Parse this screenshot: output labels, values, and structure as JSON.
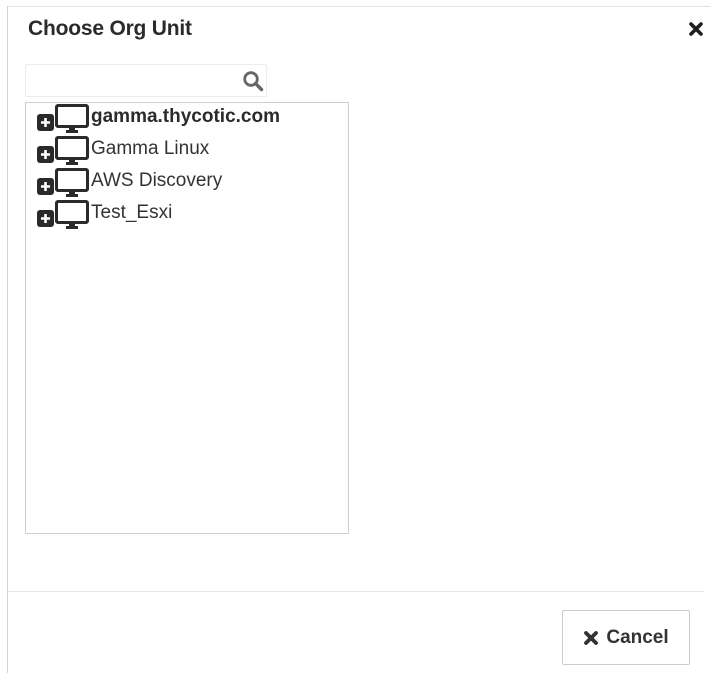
{
  "dialog": {
    "title": "Choose Org Unit",
    "close_icon": "close-icon"
  },
  "search": {
    "value": "",
    "placeholder": "",
    "icon": "search-icon"
  },
  "tree": {
    "items": [
      {
        "label": "gamma.thycotic.com",
        "selected": true,
        "icon": "computer-icon",
        "expand_icon": "expand-plus-icon"
      },
      {
        "label": "Gamma Linux",
        "selected": false,
        "icon": "computer-icon",
        "expand_icon": "expand-plus-icon"
      },
      {
        "label": "AWS Discovery",
        "selected": false,
        "icon": "computer-icon",
        "expand_icon": "expand-plus-icon"
      },
      {
        "label": "Test_Esxi",
        "selected": false,
        "icon": "computer-icon",
        "expand_icon": "expand-plus-icon"
      }
    ]
  },
  "footer": {
    "cancel_label": "Cancel",
    "cancel_icon": "times-icon"
  },
  "colors": {
    "text": "#333333",
    "border": "#cccccc",
    "icon": "#2a2a2a"
  }
}
